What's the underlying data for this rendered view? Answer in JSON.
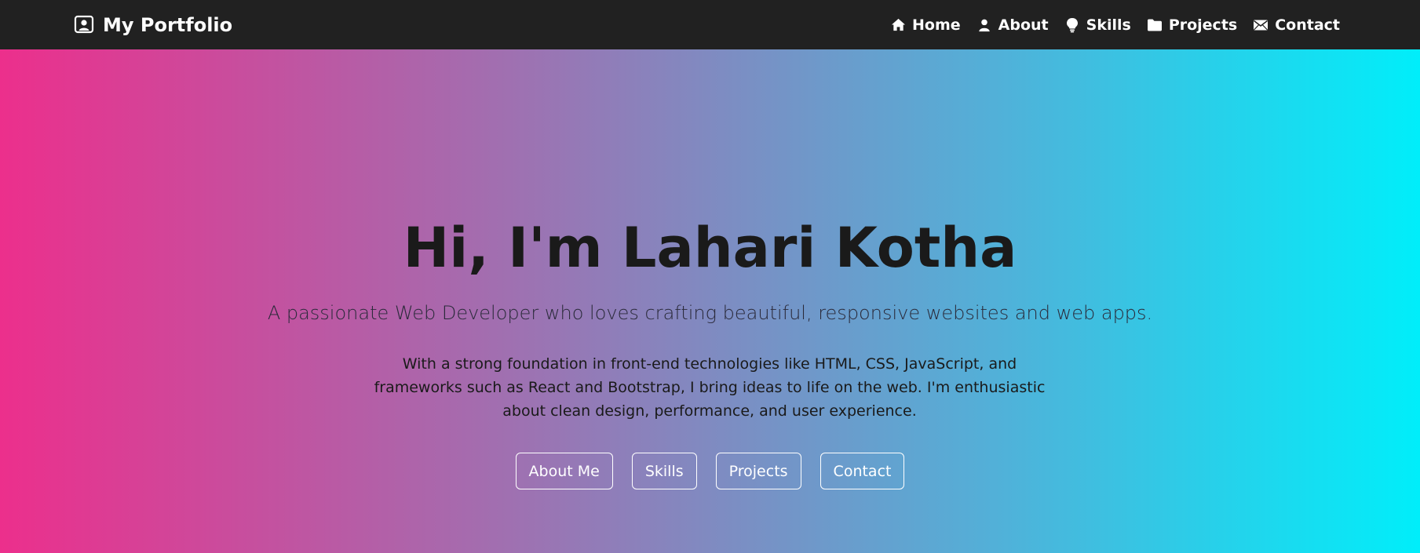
{
  "navbar": {
    "brand": {
      "icon": "person-badge-icon",
      "label": "My Portfolio"
    },
    "links": [
      {
        "icon": "home-icon",
        "label": "Home"
      },
      {
        "icon": "person-icon",
        "label": "About"
      },
      {
        "icon": "lightbulb-icon",
        "label": "Skills"
      },
      {
        "icon": "folder-icon",
        "label": "Projects"
      },
      {
        "icon": "envelope-icon",
        "label": "Contact"
      }
    ]
  },
  "hero": {
    "title": "Hi, I'm Lahari Kotha",
    "subtitle": "A passionate Web Developer who loves crafting beautiful, responsive websites and web apps.",
    "description": "With a strong foundation in front-end technologies like HTML, CSS, JavaScript, and frameworks such as React and Bootstrap, I bring ideas to life on the web. I'm enthusiastic about clean design, performance, and user experience.",
    "buttons": [
      "About Me",
      "Skills",
      "Projects",
      "Contact"
    ]
  },
  "colors": {
    "navbar_bg": "#212121",
    "gradient_start": "#ec2f8c",
    "gradient_end": "#00eefa",
    "text_dark": "#1a1a1a",
    "button_border": "#ffffff"
  }
}
